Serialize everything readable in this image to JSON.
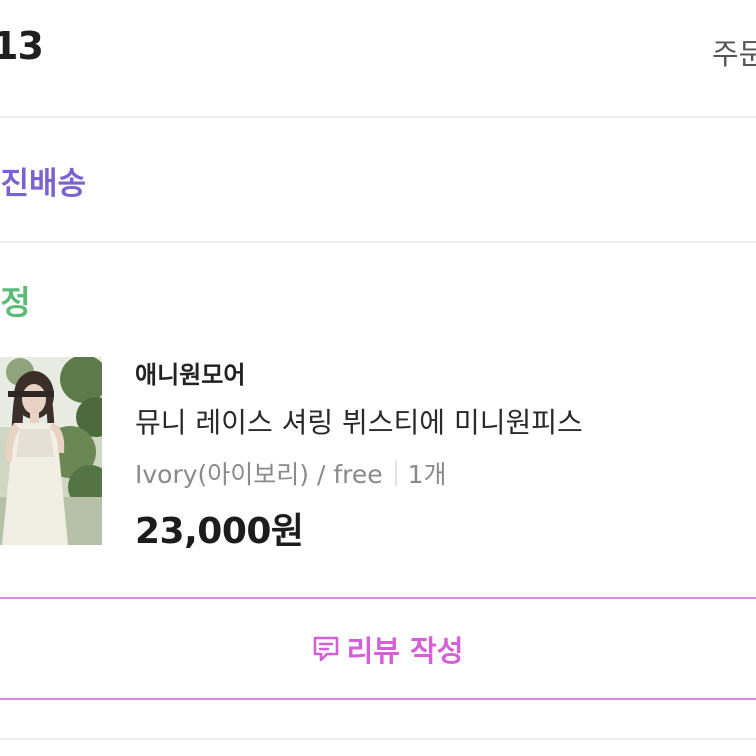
{
  "header": {
    "order_date_fragment": "13",
    "order_detail_link": "주문"
  },
  "delivery": {
    "type_label": "직진배송",
    "color": "#7b63cf"
  },
  "status": {
    "label": "확정",
    "color": "#5dbb78"
  },
  "product": {
    "brand": "애니원모어",
    "name": "뮤니 레이스 셔링 뷔스티에 미니원피스",
    "option": "Ivory(아이보리) / free",
    "quantity": "1개",
    "price": "23,000원"
  },
  "review_button": {
    "icon": "review-speech-bubble-icon",
    "label": "리뷰 작성",
    "color": "#d55fd6"
  }
}
